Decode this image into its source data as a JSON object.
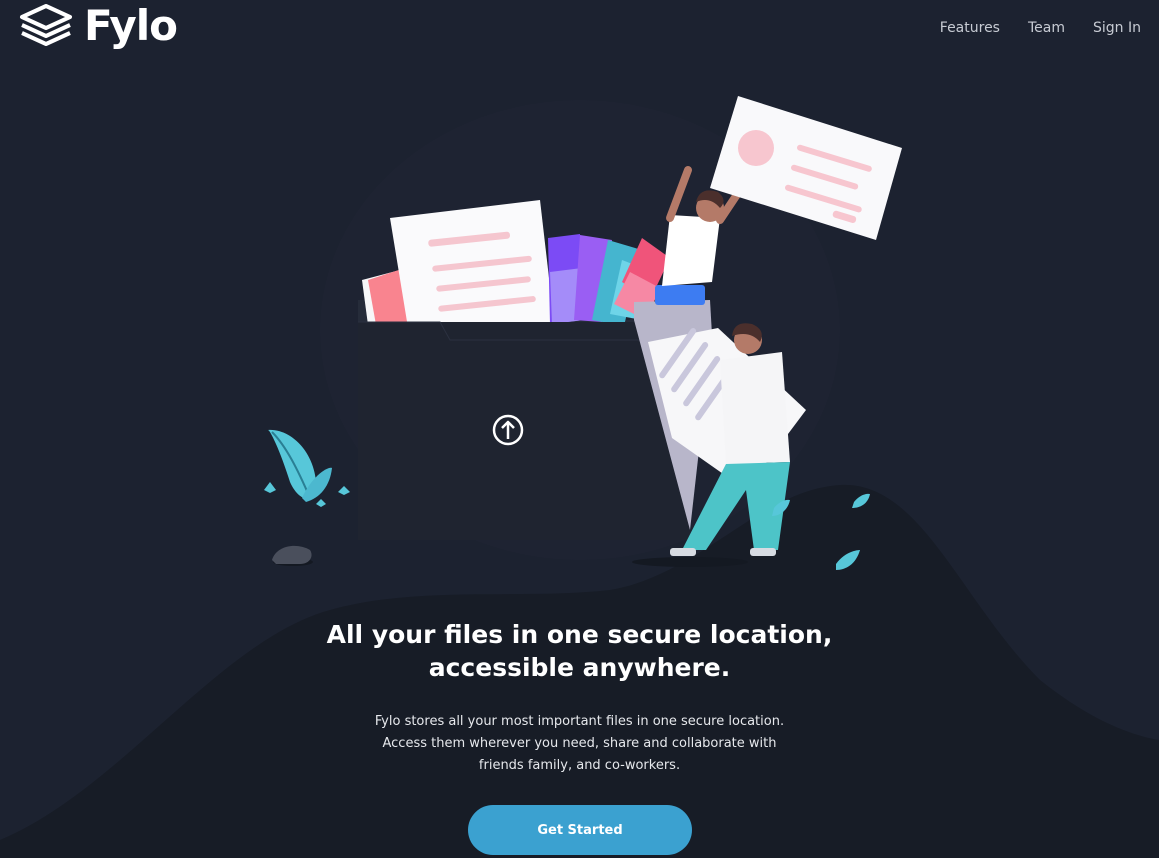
{
  "header": {
    "logo_text": "Fylo",
    "nav": [
      {
        "label": "Features"
      },
      {
        "label": "Team"
      },
      {
        "label": "Sign In"
      }
    ]
  },
  "hero": {
    "title_line1": "All your files in one secure location,",
    "title_line2": "accessible anywhere.",
    "desc_line1": "Fylo stores all your most important files in one secure location.",
    "desc_line2": "Access them wherever you need, share and collaborate with",
    "desc_line3": "friends family, and co-workers.",
    "cta_label": "Get Started"
  },
  "colors": {
    "background": "#1c2230",
    "curve": "#181e29",
    "accent": "#3ba1d0"
  },
  "icons": {
    "logo": "layers-icon",
    "upload": "upload-arrow-icon"
  }
}
